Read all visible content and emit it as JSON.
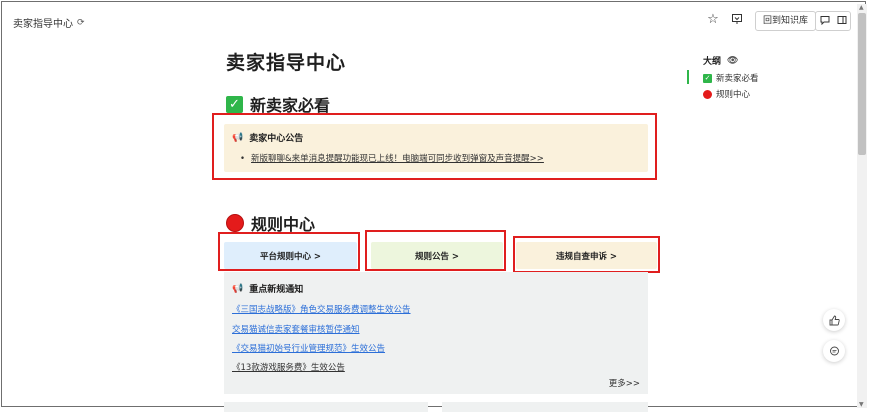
{
  "topbar": {
    "doc_title": "卖家指导中心",
    "sync_icon": "sync-icon",
    "back_to_kb": "回到知识库"
  },
  "page": {
    "title": "卖家指导中心",
    "section1_title": "新卖家必看",
    "notice": {
      "title": "卖家中心公告",
      "item_bullet": "•",
      "item_text": "新版聊聊&来单消息提醒功能现已上线！电脑端可同步收到弹窗及声音提醒>>"
    },
    "section2_title": "规则中心",
    "rule_buttons": [
      {
        "label": "平台规则中心 >",
        "color": "#dfeefc"
      },
      {
        "label": "规则公告 >",
        "color": "#edf6dd"
      },
      {
        "label": "违规自查申诉 >",
        "color": "#faf1dc"
      }
    ],
    "news": {
      "title": "重点新规通知",
      "links": [
        "《三国志战略版》角色交易服务费调整生效公告",
        "交易猫诚信卖家套餐审核暂停通知",
        "《交易猫初始号行业管理规范》生效公告",
        "《13款游戏服务费》生效公告"
      ],
      "more": "更多>>"
    }
  },
  "outline": {
    "title": "大纲",
    "items": [
      "新卖家必看",
      "规则中心"
    ]
  },
  "colors": {
    "highlight_red": "#e01e1e",
    "check_green": "#2fb64a",
    "link_blue": "#2c6fd8"
  }
}
